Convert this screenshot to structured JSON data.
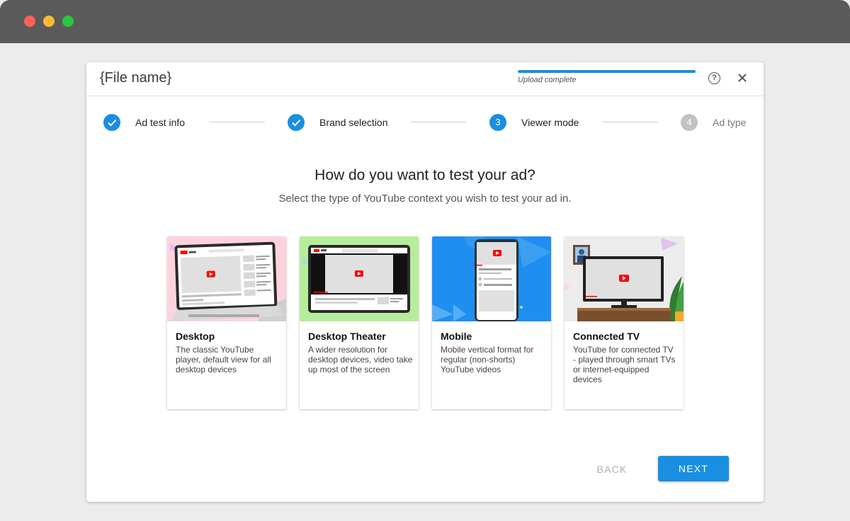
{
  "dialog": {
    "file_name": "{File name}",
    "upload_status": "Upload complete",
    "upload_progress": 1.0
  },
  "steps": [
    {
      "number": "1",
      "label": "Ad test info",
      "state": "done"
    },
    {
      "number": "2",
      "label": "Brand selection",
      "state": "done"
    },
    {
      "number": "3",
      "label": "Viewer mode",
      "state": "current"
    },
    {
      "number": "4",
      "label": "Ad type",
      "state": "todo"
    }
  ],
  "main": {
    "heading": "How do you want to test your ad?",
    "subheading": "Select the type of YouTube context you wish to test your ad in."
  },
  "options": [
    {
      "title": "Desktop",
      "description": "The classic YouTube player, default view for all desktop devices",
      "bg_color": "#ffd3de"
    },
    {
      "title": "Desktop Theater",
      "description": "A wider resolution for desktop devices, video take up most of the screen",
      "bg_color": "#b6ed9c"
    },
    {
      "title": "Mobile",
      "description": "Mobile vertical format for regular (non-shorts) YouTube videos",
      "bg_color": "#1e8ff0"
    },
    {
      "title": "Connected TV",
      "description": "YouTube for connected TV - played through smart TVs or internet-equipped devices",
      "bg_color": "#ececec"
    }
  ],
  "actions": {
    "back_label": "BACK",
    "next_label": "NEXT"
  },
  "colors": {
    "accent": "#1a8ee1",
    "youtube_red": "#ff0000"
  }
}
